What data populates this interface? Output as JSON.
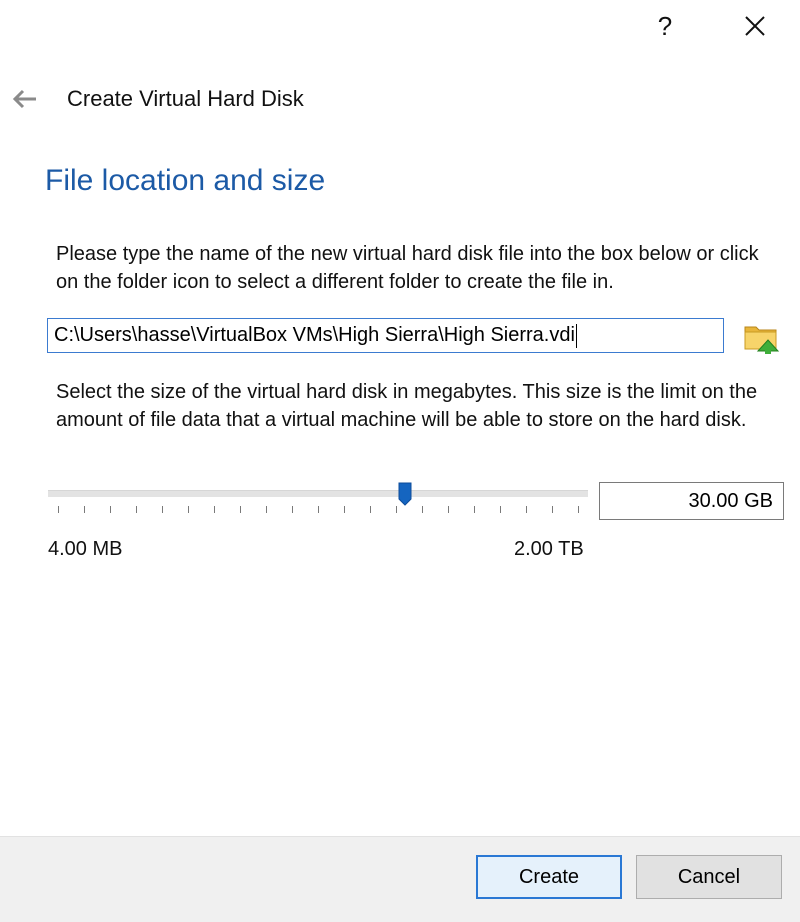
{
  "titlebar": {
    "help_label": "?",
    "close_icon": "close-icon"
  },
  "header": {
    "back_icon": "back-arrow-icon",
    "title": "Create Virtual Hard Disk"
  },
  "page": {
    "heading": "File location and size",
    "location_description": "Please type the name of the new virtual hard disk file into the box below or click on the folder icon to select a different folder to create the file in.",
    "file_path": "C:\\Users\\hasse\\VirtualBox VMs\\High Sierra\\High Sierra.vdi",
    "folder_icon": "folder-icon",
    "size_description": "Select the size of the virtual hard disk in megabytes. This size is the limit on the amount of file data that a virtual machine will be able to store on the hard disk.",
    "slider": {
      "min_label": "4.00 MB",
      "max_label": "2.00 TB",
      "position_fraction": 0.667,
      "tick_count": 21
    },
    "size_value": "30.00 GB"
  },
  "footer": {
    "create_label": "Create",
    "cancel_label": "Cancel"
  },
  "colors": {
    "heading": "#1c5aa6",
    "focus_border": "#3b7bd0",
    "slider_handle": "#1565c0",
    "default_button_border": "#2a78d4"
  }
}
